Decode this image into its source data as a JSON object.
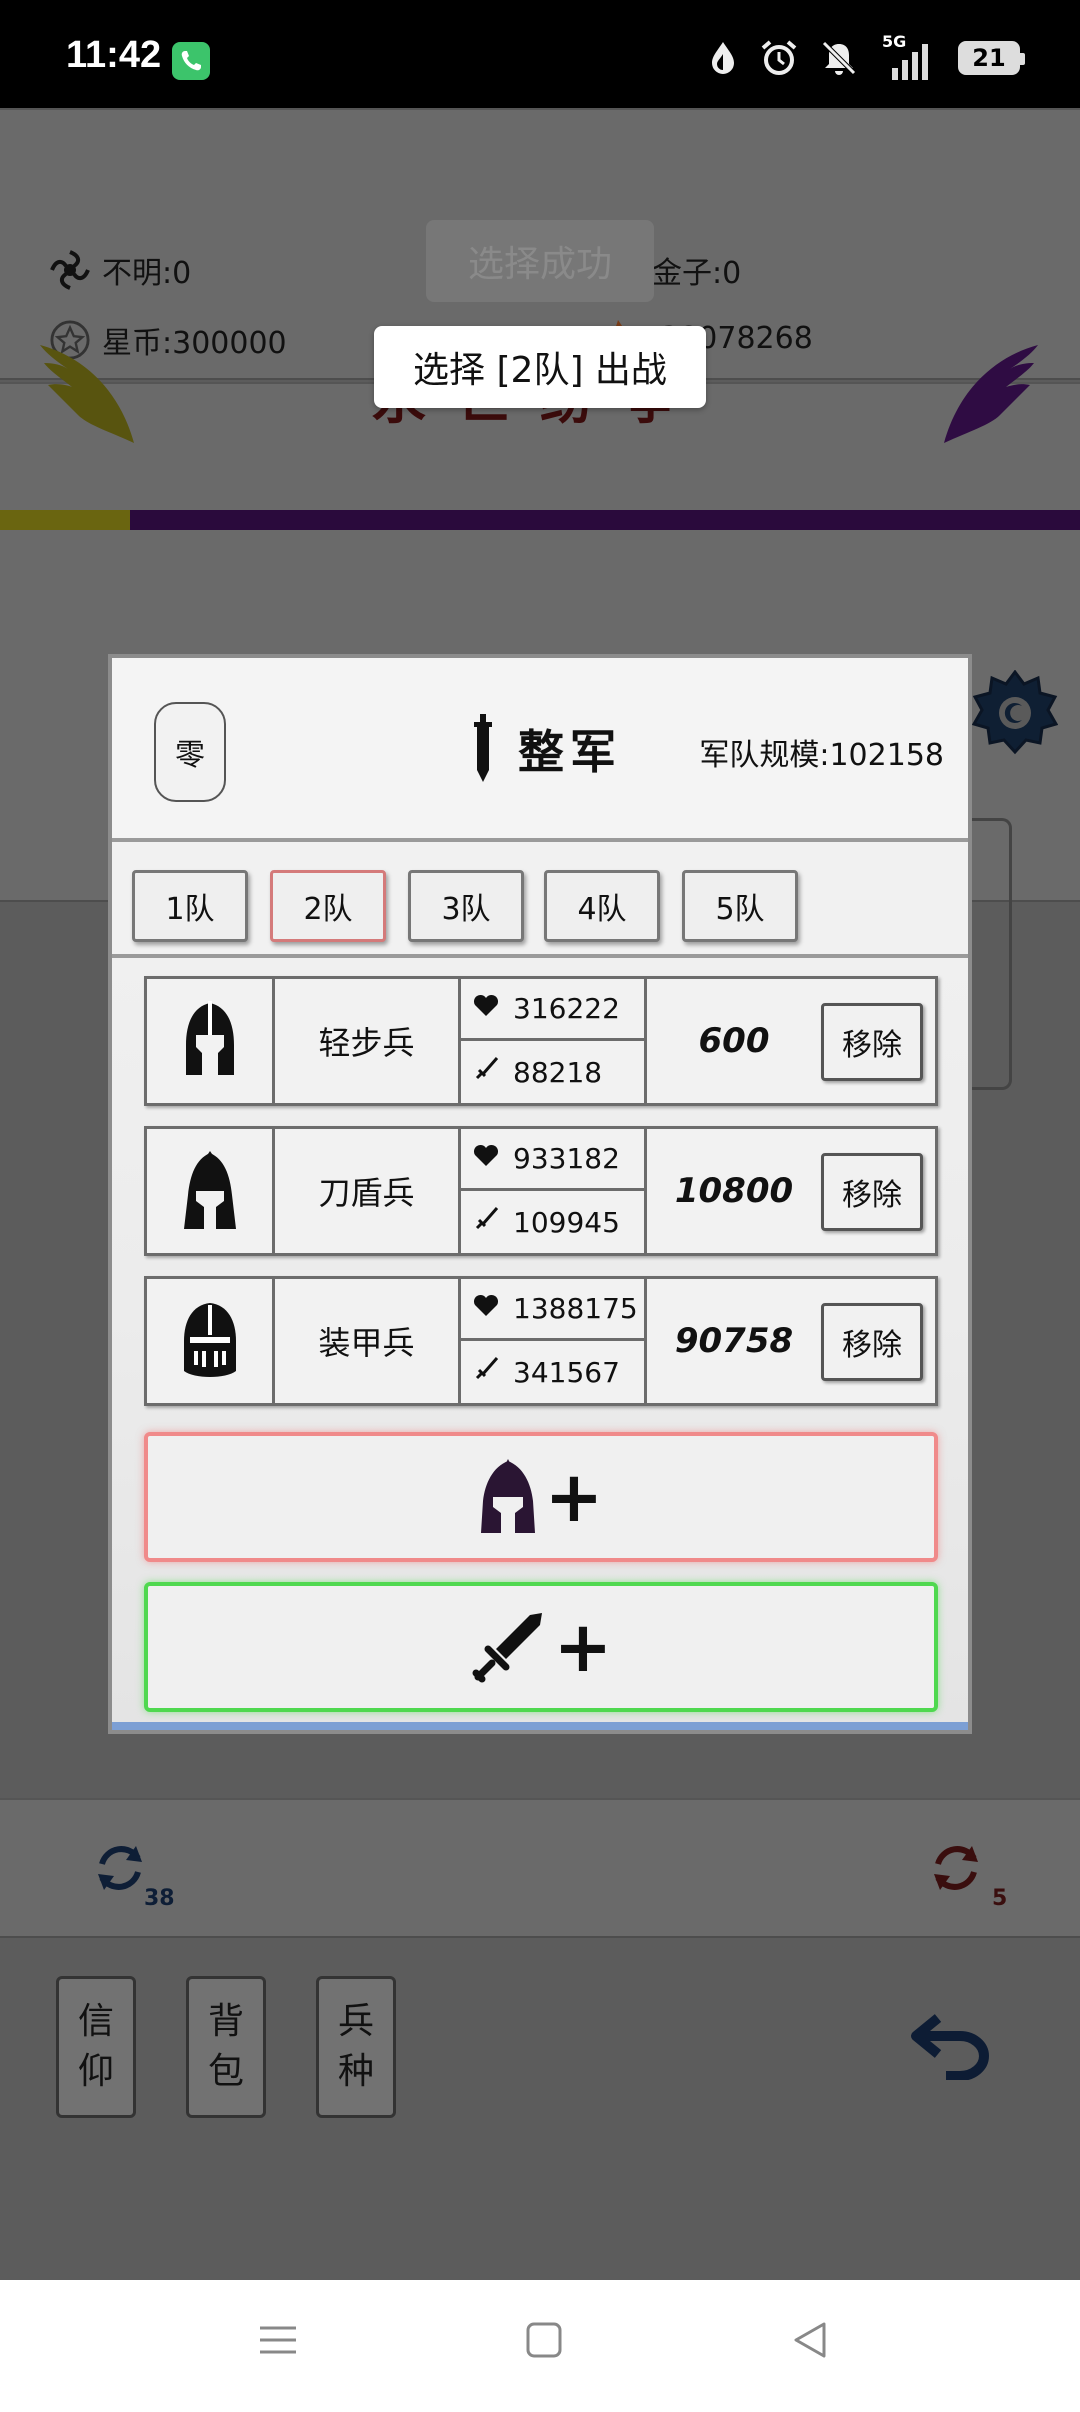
{
  "status_bar": {
    "time": "11:42",
    "network": "5G",
    "battery": "21"
  },
  "resources": {
    "unknown": "不明:0",
    "gold": "金子:0",
    "starcoin": "星币:300000",
    "other": ":38078268"
  },
  "game_title": "永世纷争",
  "toasts": {
    "faded": "选择成功",
    "main": "选择 [2队] 出战"
  },
  "modal": {
    "zero_button": "零",
    "title": "整军",
    "army_size": "军队规模:102158",
    "tabs": [
      "1队",
      "2队",
      "3队",
      "4队",
      "5队"
    ],
    "active_tab": "2队",
    "units": [
      {
        "name": "轻步兵",
        "hp": "316222",
        "atk": "88218",
        "count": "600",
        "remove": "移除"
      },
      {
        "name": "刀盾兵",
        "hp": "933182",
        "atk": "109945",
        "count": "10800",
        "remove": "移除"
      },
      {
        "name": "装甲兵",
        "hp": "1388175",
        "atk": "341567",
        "count": "90758",
        "remove": "移除"
      }
    ],
    "add_unit_plus": "+",
    "add_weapon_plus": "+"
  },
  "refresh": {
    "left_count": "38",
    "right_count": "5"
  },
  "side_buttons": {
    "faith": [
      "信",
      "仰"
    ],
    "bag": [
      "背",
      "包"
    ],
    "troops": [
      "兵",
      "种"
    ]
  },
  "colors": {
    "accent_yellow": "#c9b800",
    "accent_purple": "#3f0a5e",
    "title_red": "#3b0b0b",
    "add_unit_border": "#f08a8a",
    "add_weapon_border": "#4fd84f",
    "active_tab_border": "#d47a7a"
  }
}
